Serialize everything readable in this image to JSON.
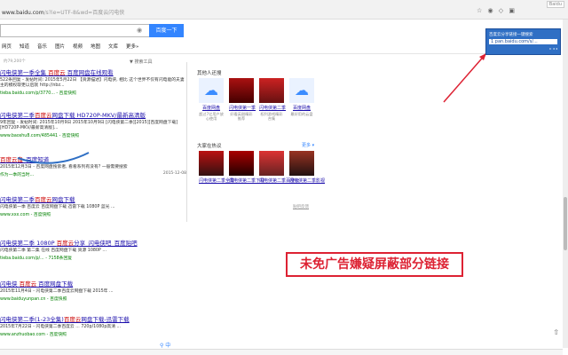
{
  "browser": {
    "url_host": "www.baidu.com",
    "url_rest": "/s?ie=UTF-8&wd=百度云闪电侠",
    "badge": "Baidu"
  },
  "search": {
    "query": "",
    "button": "百度一下"
  },
  "nav": {
    "tabs": [
      "网页",
      "知道",
      "音乐",
      "图片",
      "视频",
      "地图",
      "文库",
      "更多»"
    ],
    "tools": "搜索工具",
    "count": "约79,200个"
  },
  "results": [
    {
      "title_parts": [
        "闪电侠第一季全集 ",
        "百度云",
        " 百度网盘在线观看"
      ],
      "desc": "522条回复 - 发帖时间: 2015年5月22日 【资源描述】闪电侠, 相比 这个世界不仅有闪电能的夫妻主的模权取更以后就 http://nbz...",
      "url": "tieba.baidu.com/p/3770... - 百度快照"
    },
    {
      "title_parts": [
        "闪电侠第二季",
        "百度云",
        "网盘下载 HD720P-MKV/最新高清版"
      ],
      "desc": "9年回复 - 发帖时间: 2015年10月9日 2015年10月9日 [闪电侠第二季][2015][百度网盘下载][HD720P-MKV/最新高清版]...",
      "url": "www.baoshu8.com/485441 - 百度快照"
    },
    {
      "title_parts": [
        "",
        "百度云盘",
        "_百度知道"
      ],
      "desc": "2015年12月3日 - 百度网盘搜索者, 看看系列有没有? 一般需要搜索",
      "url": "作为一季的当时...",
      "date": "2015-12-08"
    },
    {
      "title_parts": [
        "闪电侠第二季",
        "百度云",
        "网盘下载"
      ],
      "desc": "闪电侠第一季 百度云 百度网盘下载 迅雷下载 1080P 蓝光 ...",
      "url": "www.xxx.com - 百度快照"
    },
    {
      "title_parts": [
        "闪电侠第二季 1080P ",
        "百度云",
        "分享_闪电侠吧_百度贴吧"
      ],
      "desc": "闪电侠第二季 第二集 在线 百度网盘下载 资源 1080P ...",
      "url": "tieba.baidu.com/p/... - 7158条回复"
    },
    {
      "title_parts": [
        "闪电侠 ",
        "百度云",
        " 百度网盘下载"
      ],
      "desc": "2015年11月4日 - 闪电侠第二季百度云网盘下载 2015年 ...",
      "url": "www.baiduyunpan.cn - 百度快照"
    },
    {
      "title_parts": [
        "闪电侠第二季(1-23全集)",
        "百度云",
        "网盘下载-迅雷下载"
      ],
      "desc": "2015年7月22日 - 闪电侠第二季百度云 ... 720p/1080p高清 ...",
      "url": "www.anzhuobao.com - 百度快照"
    }
  ],
  "sidebar": {
    "heading1": "其他人还搜",
    "heading2": "大家在热议",
    "more": "更多",
    "feedback": "贴吧反馈",
    "row1": [
      {
        "name": "百度网盘",
        "sub": "超过7亿用户放心使用"
      },
      {
        "name": "闪电侠第一季",
        "sub": "好看英剧精彩推荐"
      },
      {
        "name": "闪电侠第二季",
        "sub": "权利游戏精彩合集"
      },
      {
        "name": "百度网盘",
        "sub": "最好用的云盘"
      }
    ],
    "row2": [
      {
        "name": "闪电侠第二季全集",
        "sub": ""
      },
      {
        "name": "闪电侠第二季下载",
        "sub": ""
      },
      {
        "name": "闪电侠第二季百度云",
        "sub": ""
      },
      {
        "name": "闪电侠第二季影视",
        "sub": ""
      }
    ]
  },
  "annotation": "未免广告嫌疑屏蔽部分链接",
  "popup": {
    "line1": "百度云分享链接一键搜索",
    "line2": "1 pan.baidu.com/s/..."
  },
  "colors": {
    "accent": "#3385ff",
    "link": "#1a0dab",
    "highlight": "#c00",
    "annotation": "#d23"
  }
}
